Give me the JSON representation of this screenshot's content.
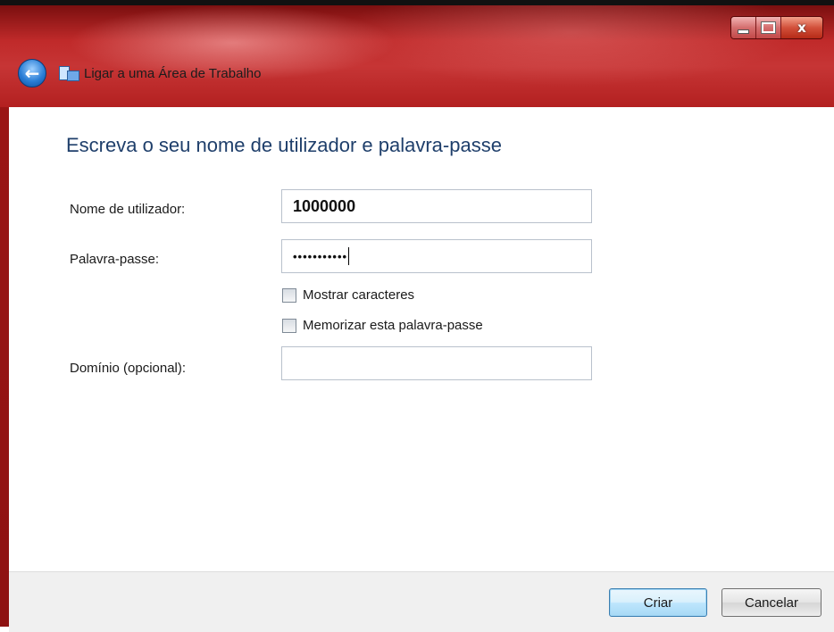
{
  "window": {
    "title": "Ligar a uma Área de Trabalho",
    "caption_buttons": [
      "minimize",
      "maximize",
      "close"
    ],
    "close_glyph": "x"
  },
  "nav": {
    "back_icon": "back-arrow-icon",
    "back_glyph": "←",
    "app_icon": "remote-desktop-icon"
  },
  "form": {
    "heading": "Escreva o seu nome de utilizador e palavra-passe",
    "username": {
      "label": "Nome de utilizador:",
      "value": "1000000"
    },
    "password": {
      "label": "Palavra-passe:",
      "masked_value": "•••••••••••"
    },
    "show_characters": {
      "label": "Mostrar caracteres",
      "checked": false
    },
    "remember_password": {
      "label": "Memorizar esta palavra-passe",
      "checked": false
    },
    "domain": {
      "label": "Domínio (opcional):",
      "value": ""
    }
  },
  "footer": {
    "create_label": "Criar",
    "cancel_label": "Cancelar"
  },
  "colors": {
    "heading": "#1f3f6b",
    "frame": "#b52020",
    "primary_button_border": "#3c7fb1"
  }
}
